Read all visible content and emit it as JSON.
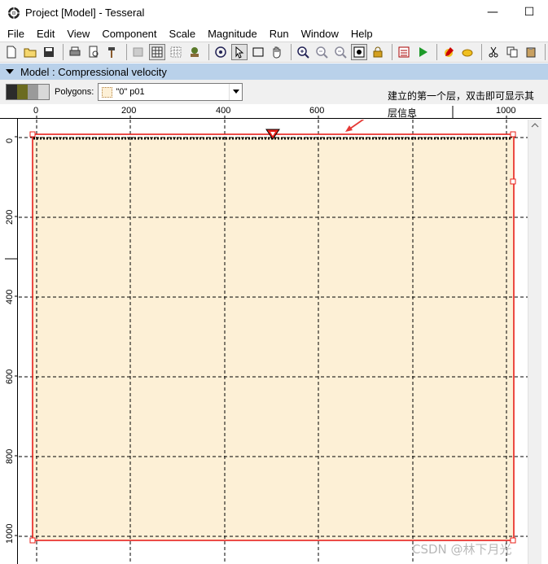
{
  "window": {
    "title": "Project [Model] - Tesseral",
    "app_icon": "tesseral-logo-icon",
    "minimize_label": "—",
    "maximize_label": "☐"
  },
  "menu": [
    "File",
    "Edit",
    "View",
    "Component",
    "Scale",
    "Magnitude",
    "Run",
    "Window",
    "Help"
  ],
  "toolbar": {
    "icons": [
      "new-file-icon",
      "open-folder-icon",
      "save-icon",
      "print-icon",
      "print-preview-icon",
      "hammer-icon",
      "layers-icon",
      "grid-view-icon",
      "dotted-grid-icon",
      "tree-icon",
      "zoom-target-icon",
      "pointer-icon",
      "rectangle-select-icon",
      "hand-pan-icon",
      "zoom-in-icon",
      "zoom-out-icon",
      "zoom-reset-icon",
      "fit-window-icon",
      "lock-icon",
      "calculator-icon",
      "run-play-icon",
      "edit-pen-icon",
      "eraser-icon",
      "cut-icon",
      "copy-icon",
      "paste-icon",
      "undo-icon"
    ]
  },
  "panel": {
    "title": "Model : Compressional velocity",
    "collapse_icon": "triangle-down-icon"
  },
  "polygons": {
    "label": "Polygons:",
    "selected": "\"0\" p01",
    "swatch_colors": [
      "#2b2b2b",
      "#6b6b20",
      "#9a9a9a",
      "#d8d8d8"
    ]
  },
  "annotation": {
    "text": "建立的第一个层，双击即可显示其层信息",
    "color": "#e53935"
  },
  "rulers": {
    "x_ticks": [
      "0",
      "200",
      "400",
      "600",
      "1000"
    ],
    "y_ticks": [
      "0",
      "200",
      "400",
      "600",
      "800",
      "1000"
    ]
  },
  "model": {
    "fill_color": "#fdf0d6",
    "border_color": "#e8201a",
    "x_range": [
      0,
      1000
    ],
    "y_range": [
      0,
      1000
    ]
  },
  "watermark": "CSDN @林下月光"
}
